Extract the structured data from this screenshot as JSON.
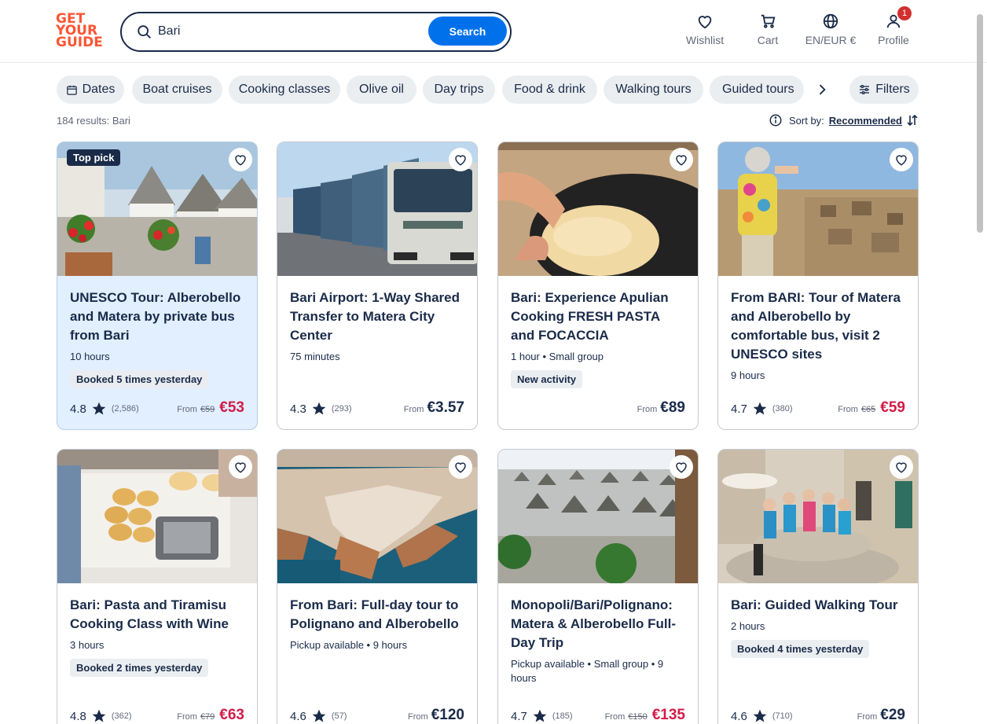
{
  "header": {
    "logo_lines": [
      "GET",
      "YOUR",
      "GUIDE"
    ],
    "search_value": "Bari",
    "search_button": "Search",
    "nav": [
      {
        "label": "Wishlist",
        "icon": "heart-icon"
      },
      {
        "label": "Cart",
        "icon": "cart-icon"
      },
      {
        "label": "EN/EUR €",
        "icon": "globe-icon"
      },
      {
        "label": "Profile",
        "icon": "profile-icon",
        "badge": "1"
      }
    ]
  },
  "chips": [
    "Dates",
    "Boat cruises",
    "Cooking classes",
    "Olive oil",
    "Day trips",
    "Food & drink",
    "Walking tours",
    "Guided tours"
  ],
  "filters_label": "Filters",
  "results_text": "184 results: Bari",
  "sort": {
    "label": "Sort by:",
    "value": "Recommended"
  },
  "cards": [
    {
      "badge": "Top pick",
      "title": "UNESCO Tour: Alberobello and Matera by private bus from Bari",
      "meta": "10 hours",
      "tag": "Booked 5 times yesterday",
      "rating": "4.8",
      "reviews": "(2,586)",
      "from": "From",
      "old_price": "€59",
      "price": "€53",
      "sale": true,
      "highlight": true
    },
    {
      "title": "Bari Airport: 1-Way Shared Transfer to Matera City Center",
      "meta": "75 minutes",
      "rating": "4.3",
      "reviews": "(293)",
      "from": "From",
      "price": "€3.57"
    },
    {
      "title": "Bari: Experience Apulian Cooking FRESH PASTA and FOCACCIA",
      "meta": "1 hour • Small group",
      "tag": "New activity",
      "from": "From",
      "price": "€89"
    },
    {
      "title": "From BARI: Tour of Matera and Alberobello by comfortable bus, visit 2 UNESCO sites",
      "meta": "9 hours",
      "rating": "4.7",
      "reviews": "(380)",
      "from": "From",
      "old_price": "€65",
      "price": "€59",
      "sale": true
    },
    {
      "title": "Bari: Pasta and Tiramisu Cooking Class with Wine",
      "meta": "3 hours",
      "tag": "Booked 2 times yesterday",
      "rating": "4.8",
      "reviews": "(362)",
      "from": "From",
      "old_price": "€79",
      "price": "€63",
      "sale": true
    },
    {
      "title": "From Bari: Full-day tour to Polignano and Alberobello",
      "meta": "Pickup available • 9 hours",
      "rating": "4.6",
      "reviews": "(57)",
      "from": "From",
      "price": "€120"
    },
    {
      "title": "Monopoli/Bari/Polignano: Matera & Alberobello Full-Day Trip",
      "meta": "Pickup available • Small group • 9 hours",
      "rating": "4.7",
      "reviews": "(185)",
      "from": "From",
      "old_price": "€150",
      "price": "€135",
      "sale": true
    },
    {
      "title": "Bari: Guided Walking Tour",
      "meta": "2 hours",
      "tag": "Booked 4 times yesterday",
      "rating": "4.6",
      "reviews": "(710)",
      "from": "From",
      "price": "€29"
    }
  ],
  "colors": {
    "brand": "#ff5533",
    "primary": "#0071eb",
    "navy": "#1a2b49",
    "sale": "#d21c47"
  }
}
